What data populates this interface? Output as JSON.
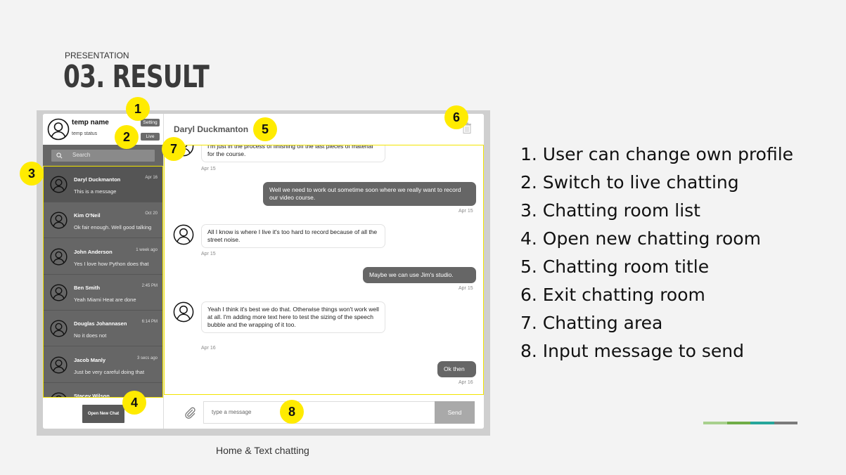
{
  "slide": {
    "label": "PRESENTATION",
    "title": "03. RESULT",
    "caption": "Home & Text chatting",
    "legend": [
      "1. User can change own profile",
      "2. Switch to live chatting",
      "3. Chatting room list",
      "4. Open new chatting room",
      "5. Chatting room title",
      "6. Exit chatting room",
      "7. Chatting area",
      "8. Input message to send"
    ],
    "badges": [
      "1",
      "2",
      "3",
      "4",
      "5",
      "6",
      "7",
      "8"
    ],
    "accent_colors": [
      "#a8d08d",
      "#70ad47",
      "#26a69a",
      "#7a7a7a"
    ]
  },
  "profile": {
    "name": "temp name",
    "status": "temp status",
    "setting_label": "Setting",
    "live_label": "Live"
  },
  "search": {
    "placeholder": "Search"
  },
  "rooms": [
    {
      "name": "Daryl Duckmanton",
      "time": "Apr 16",
      "message": "This is a message"
    },
    {
      "name": "Kim O'Neil",
      "time": "Oct 20",
      "message": "Ok fair enough. Well good talking"
    },
    {
      "name": "John Anderson",
      "time": "1 week ago",
      "message": "Yes I love how Python does that"
    },
    {
      "name": "Ben Smith",
      "time": "2:45 PM",
      "message": "Yeah Miami Heat are done"
    },
    {
      "name": "Douglas Johannasen",
      "time": "6:14 PM",
      "message": "No it does not"
    },
    {
      "name": "Jacob Manly",
      "time": "3 secs ago",
      "message": "Just be very careful doing that"
    },
    {
      "name": "Stacey Wilson",
      "time": "",
      "message": ""
    }
  ],
  "new_chat_label": "Open New Chat",
  "chat": {
    "title": "Daryl Duckmanton",
    "messages": [
      {
        "text": "I'm just in the process of finishing off the last pieces of material for the course.",
        "time": "Apr 15"
      },
      {
        "text": "Well we need to work out sometime soon where we really want to record our video course.",
        "time": "Apr 15"
      },
      {
        "text": "All I know is where I live it's too hard to record because of all the street noise.",
        "time": "Apr 15"
      },
      {
        "text": "Maybe we can use Jim's studio.",
        "time": "Apr 15"
      },
      {
        "text": "Yeah I think it's best we do that. Otherwise things won't work well at all. I'm adding more text here to test the sizing of the speech bubble and the wrapping of it too.",
        "time": "Apr 16"
      },
      {
        "text": "Ok then",
        "time": "Apr 16"
      }
    ]
  },
  "composer": {
    "placeholder": "type a message",
    "send_label": "Send"
  }
}
